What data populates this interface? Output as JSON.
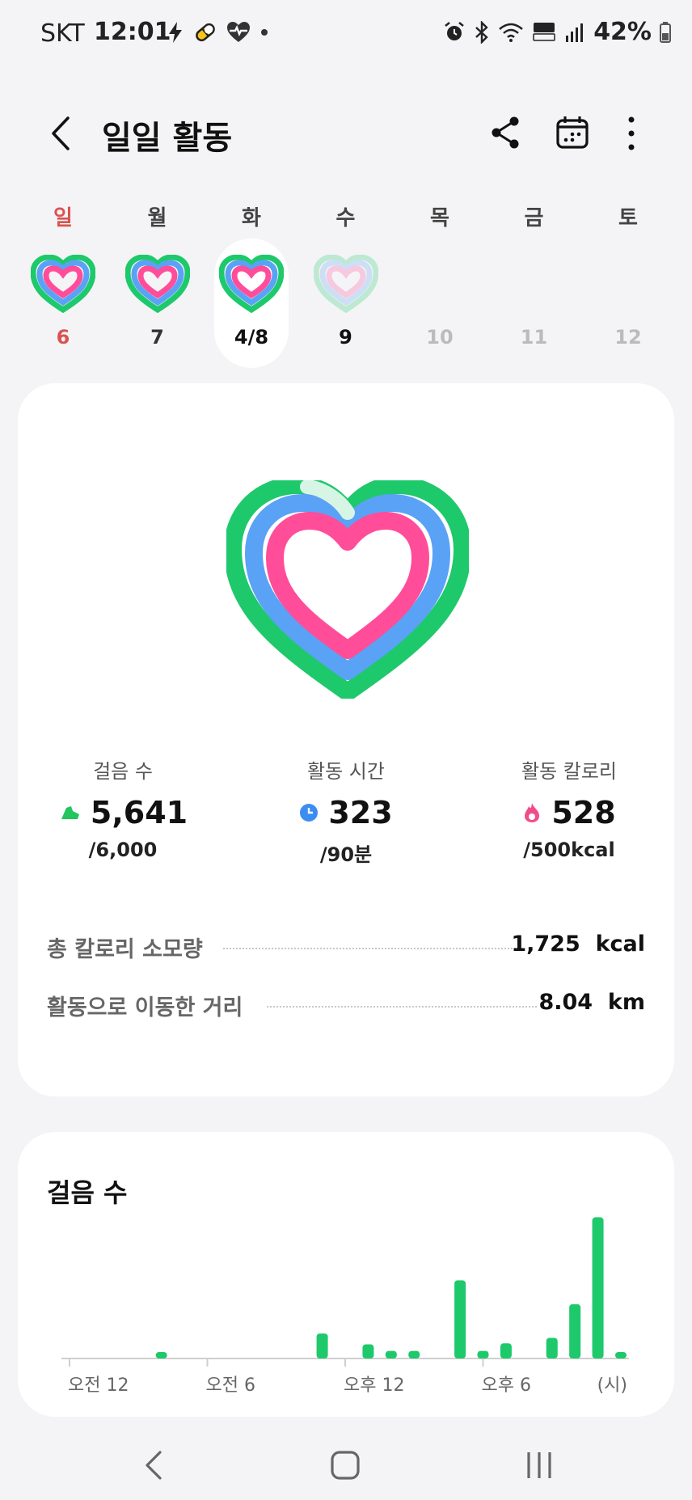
{
  "status": {
    "carrier": "SKT",
    "time": "12:01",
    "battery": "42%"
  },
  "header": {
    "title": "일일 활동"
  },
  "week": [
    {
      "name": "일",
      "date": "6",
      "has_ring": true,
      "color": "#d9534f"
    },
    {
      "name": "월",
      "date": "7",
      "has_ring": true,
      "color": "#333333"
    },
    {
      "name": "화",
      "date": "4/8",
      "has_ring": true,
      "color": "#111111",
      "selected": true
    },
    {
      "name": "수",
      "date": "9",
      "has_ring": true,
      "faded": true,
      "color": "#111111"
    },
    {
      "name": "목",
      "date": "10",
      "has_ring": false,
      "color": "#bbbbbb"
    },
    {
      "name": "금",
      "date": "11",
      "has_ring": false,
      "color": "#bbbbbb"
    },
    {
      "name": "토",
      "date": "12",
      "has_ring": false,
      "color": "#bbbbbb"
    }
  ],
  "stats": {
    "steps": {
      "label": "걸음 수",
      "value": "5,641",
      "goal": "/6,000",
      "color": "#22c55e"
    },
    "active_time": {
      "label": "활동 시간",
      "value": "323",
      "goal": "/90분",
      "color": "#3b8ef0"
    },
    "active_calories": {
      "label": "활동 칼로리",
      "value": "528",
      "goal": "/500kcal",
      "color": "#f04d8c"
    }
  },
  "totals": {
    "total_calories_label": "총 칼로리 소모량",
    "total_calories_value": "1,725",
    "total_calories_unit": "kcal",
    "distance_label": "활동으로 이동한 거리",
    "distance_value": "8.04",
    "distance_unit": "km"
  },
  "colors": {
    "green": "#1ec96b",
    "blue": "#5aa2f5",
    "pink": "#ff4d9a",
    "sunday": "#d9534f"
  },
  "steps_card": {
    "title": "걸음 수"
  },
  "chart_data": {
    "type": "bar",
    "x_tick_labels": [
      "오전 12",
      "오전 6",
      "오후 12",
      "오후 6",
      "(시)"
    ],
    "hours": [
      0,
      1,
      2,
      3,
      4,
      5,
      6,
      7,
      8,
      9,
      10,
      11,
      12,
      13,
      14,
      15,
      16,
      17,
      18,
      19,
      20,
      21,
      22,
      23
    ],
    "values": [
      0,
      0,
      0,
      0,
      60,
      0,
      0,
      0,
      0,
      0,
      0,
      230,
      0,
      130,
      70,
      70,
      0,
      720,
      70,
      140,
      0,
      190,
      500,
      1300,
      60
    ],
    "ylim": [
      0,
      1400
    ]
  },
  "nav": {
    "icons": [
      "back-icon",
      "home-icon",
      "recents-icon"
    ]
  }
}
